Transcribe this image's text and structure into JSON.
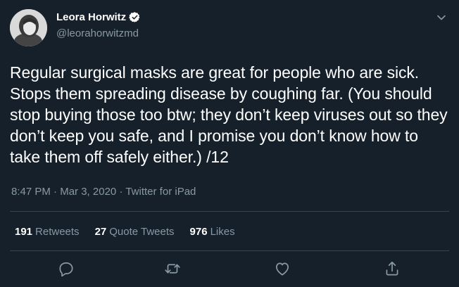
{
  "user": {
    "display_name": "Leora Horwitz",
    "handle": "@leorahorwitzmd"
  },
  "tweet": {
    "text": "Regular surgical masks are great for people who are sick. Stops them spreading disease by coughing far. (You should stop buying those too btw; they don’t keep viruses out so they don’t keep you safe, and I promise you don’t know how to take them off safely either.) /12",
    "time": "8:47 PM",
    "date": "Mar 3, 2020",
    "source": "Twitter for iPad",
    "sep": "·"
  },
  "stats": {
    "retweets_count": "191",
    "retweets_label": "Retweets",
    "quotes_count": "27",
    "quotes_label": "Quote Tweets",
    "likes_count": "976",
    "likes_label": "Likes"
  },
  "icons": {
    "verified": "verified-badge-icon",
    "caret": "chevron-down-icon",
    "reply": "reply-icon",
    "retweet": "retweet-icon",
    "like": "like-icon",
    "share": "share-icon"
  },
  "colors": {
    "background": "#15202b",
    "text_primary": "#ffffff",
    "text_secondary": "#8899a6",
    "divider": "#38444d"
  }
}
